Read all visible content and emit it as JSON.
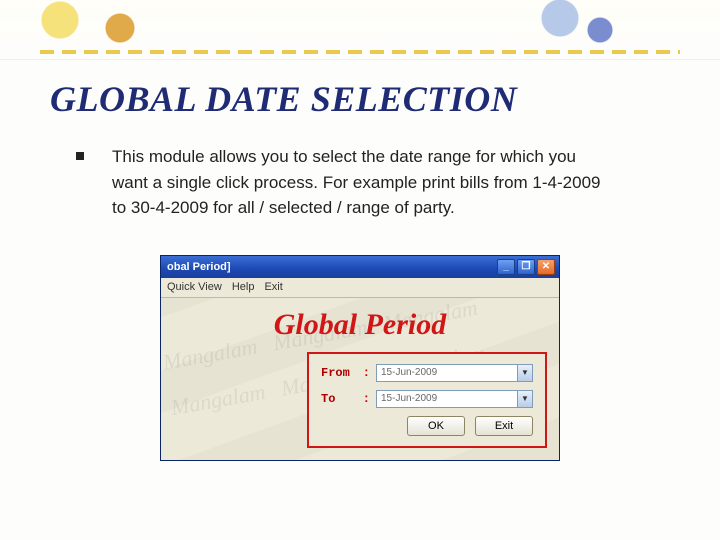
{
  "title": "GLOBAL DATE SELECTION",
  "bullet_text": "This module allows you to select the date range for which you want a single click process. For example print bills from 1-4-2009 to 30-4-2009 for all / selected / range of party.",
  "window": {
    "title_fragment": "obal Period]",
    "menu": {
      "quickview": "Quick View",
      "help": "Help",
      "exit": "Exit"
    },
    "heading": "Global Period",
    "from_label": "From",
    "to_label": "To",
    "colon": ":",
    "from_value": "15-Jun-2009",
    "to_value": "15-Jun-2009",
    "ok_label": "OK",
    "exit_label": "Exit",
    "winbtn_min": "_",
    "winbtn_max": "❐",
    "winbtn_close": "✕"
  }
}
